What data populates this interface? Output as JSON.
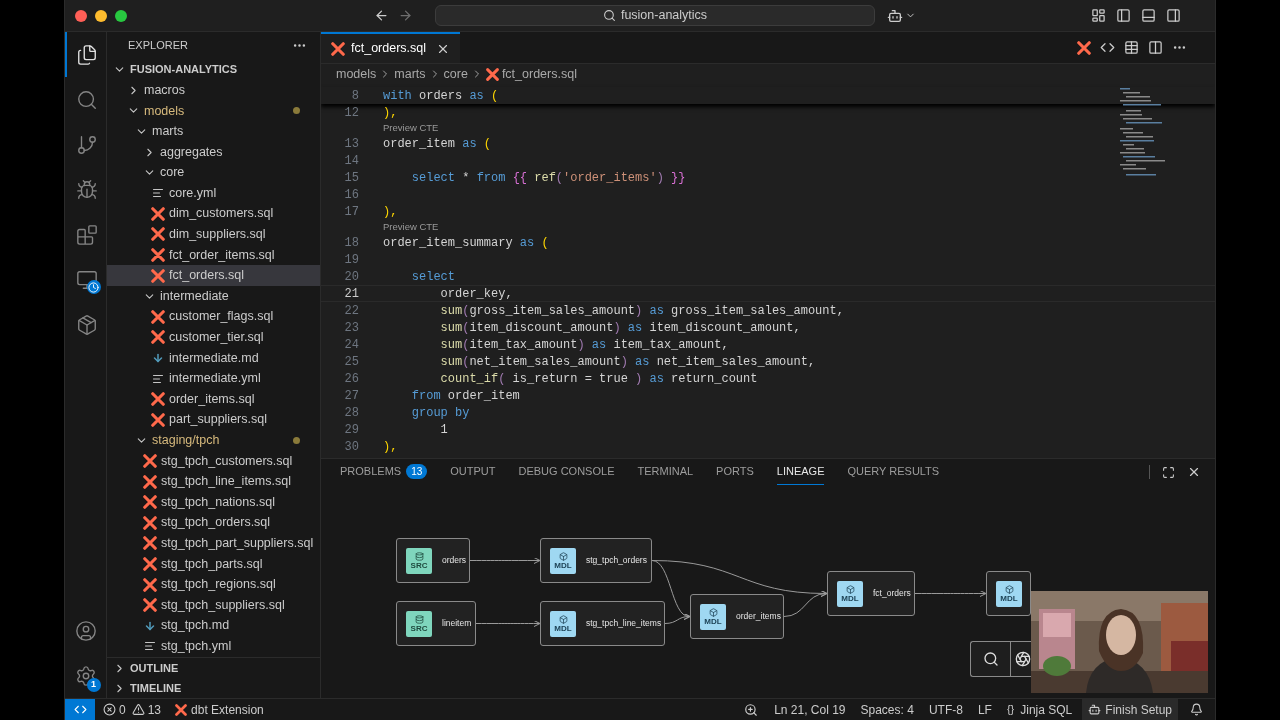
{
  "titlebar": {
    "search": "fusion-analytics"
  },
  "activity_bar": [
    {
      "kind": "files",
      "selected": true
    },
    {
      "kind": "search",
      "selected": false
    },
    {
      "kind": "git",
      "selected": false
    },
    {
      "kind": "debug",
      "selected": false
    },
    {
      "kind": "extensions",
      "selected": false
    },
    {
      "kind": "monitor",
      "selected": false
    },
    {
      "kind": "package",
      "selected": false
    }
  ],
  "activity_bottom": [
    {
      "kind": "account"
    },
    {
      "kind": "settings",
      "badge": "1"
    }
  ],
  "sidebar": {
    "title": "EXPLORER",
    "root": "FUSION-ANALYTICS",
    "items": [
      {
        "name": "macros",
        "kind": "folder",
        "expanded": false,
        "modified": false,
        "selected": false
      },
      {
        "name": "models",
        "kind": "folder",
        "expanded": true,
        "modified": true,
        "selected": false,
        "children": [
          {
            "name": "marts",
            "kind": "folder",
            "expanded": true,
            "modified": false,
            "selected": false,
            "children": [
              {
                "name": "aggregates",
                "kind": "folder",
                "expanded": false,
                "modified": false,
                "selected": false
              },
              {
                "name": "core",
                "kind": "folder",
                "expanded": true,
                "modified": false,
                "selected": false,
                "children": [
                  {
                    "name": "core.yml",
                    "kind": "yml",
                    "modified": false,
                    "selected": false
                  },
                  {
                    "name": "dim_customers.sql",
                    "kind": "dbt",
                    "modified": false,
                    "selected": false
                  },
                  {
                    "name": "dim_suppliers.sql",
                    "kind": "dbt",
                    "modified": false,
                    "selected": false
                  },
                  {
                    "name": "fct_order_items.sql",
                    "kind": "dbt",
                    "modified": false,
                    "selected": false
                  },
                  {
                    "name": "fct_orders.sql",
                    "kind": "dbt",
                    "modified": false,
                    "selected": true
                  }
                ]
              },
              {
                "name": "intermediate",
                "kind": "folder",
                "expanded": true,
                "modified": false,
                "selected": false,
                "children": [
                  {
                    "name": "customer_flags.sql",
                    "kind": "dbt",
                    "modified": false,
                    "selected": false
                  },
                  {
                    "name": "customer_tier.sql",
                    "kind": "dbt",
                    "modified": false,
                    "selected": false
                  },
                  {
                    "name": "intermediate.md",
                    "kind": "md",
                    "modified": false,
                    "selected": false
                  },
                  {
                    "name": "intermediate.yml",
                    "kind": "yml",
                    "modified": false,
                    "selected": false
                  },
                  {
                    "name": "order_items.sql",
                    "kind": "dbt",
                    "modified": false,
                    "selected": false
                  },
                  {
                    "name": "part_suppliers.sql",
                    "kind": "dbt",
                    "modified": false,
                    "selected": false
                  }
                ]
              }
            ]
          },
          {
            "name": "staging/tpch",
            "kind": "folder",
            "expanded": true,
            "modified": true,
            "selected": false,
            "children": [
              {
                "name": "stg_tpch_customers.sql",
                "kind": "dbt",
                "modified": false,
                "selected": false
              },
              {
                "name": "stg_tpch_line_items.sql",
                "kind": "dbt",
                "modified": false,
                "selected": false
              },
              {
                "name": "stg_tpch_nations.sql",
                "kind": "dbt",
                "modified": false,
                "selected": false
              },
              {
                "name": "stg_tpch_orders.sql",
                "kind": "dbt",
                "modified": false,
                "selected": false
              },
              {
                "name": "stg_tpch_part_suppliers.sql",
                "kind": "dbt",
                "modified": false,
                "selected": false
              },
              {
                "name": "stg_tpch_parts.sql",
                "kind": "dbt",
                "modified": false,
                "selected": false
              },
              {
                "name": "stg_tpch_regions.sql",
                "kind": "dbt",
                "modified": false,
                "selected": false
              },
              {
                "name": "stg_tpch_suppliers.sql",
                "kind": "dbt",
                "modified": false,
                "selected": false
              },
              {
                "name": "stg_tpch.md",
                "kind": "md",
                "modified": false,
                "selected": false
              },
              {
                "name": "stg_tpch.yml",
                "kind": "yml",
                "modified": false,
                "selected": false
              }
            ]
          }
        ]
      }
    ],
    "sections": [
      {
        "label": "OUTLINE",
        "expanded": false
      },
      {
        "label": "TIMELINE",
        "expanded": false
      }
    ]
  },
  "editor": {
    "tab": {
      "label": "fct_orders.sql"
    },
    "breadcrumb": [
      "models",
      "marts",
      "core",
      "fct_orders.sql"
    ],
    "lines": [
      {
        "kind": "code",
        "number": "8",
        "current": false,
        "tokens": [
          {
            "s": "with",
            "kind": "kw"
          },
          {
            "s": " orders ",
            "kind": "plain"
          },
          {
            "s": "as",
            "kind": "kw"
          },
          {
            "s": " (",
            "kind": "paren"
          }
        ]
      },
      {
        "kind": "code",
        "number": "12",
        "current": false,
        "tokens": [
          {
            "s": "),",
            "kind": "paren"
          }
        ]
      },
      {
        "kind": "codelens",
        "text": "Preview CTE"
      },
      {
        "kind": "code",
        "number": "13",
        "current": false,
        "tokens": [
          {
            "s": "order_item ",
            "kind": "plain"
          },
          {
            "s": "as",
            "kind": "kw"
          },
          {
            "s": " (",
            "kind": "paren"
          }
        ]
      },
      {
        "kind": "code",
        "number": "14",
        "current": false
      },
      {
        "kind": "code",
        "number": "15",
        "current": false,
        "tokens": [
          {
            "s": "    select",
            "kind": "kw"
          },
          {
            "s": " * ",
            "kind": "plain"
          },
          {
            "s": "from ",
            "kind": "kw"
          },
          {
            "s": "{{ ",
            "kind": "jinja"
          },
          {
            "s": "ref",
            "kind": "fn"
          },
          {
            "s": "(",
            "kind": "dim"
          },
          {
            "s": "'order_items'",
            "kind": "str"
          },
          {
            "s": ") ",
            "kind": "dim"
          },
          {
            "s": "}}",
            "kind": "jinja"
          }
        ]
      },
      {
        "kind": "code",
        "number": "16",
        "current": false
      },
      {
        "kind": "code",
        "number": "17",
        "current": false,
        "tokens": [
          {
            "s": "),",
            "kind": "paren"
          }
        ]
      },
      {
        "kind": "codelens",
        "text": "Preview CTE"
      },
      {
        "kind": "code",
        "number": "18",
        "current": false,
        "tokens": [
          {
            "s": "order_item_summary ",
            "kind": "plain"
          },
          {
            "s": "as",
            "kind": "kw"
          },
          {
            "s": " (",
            "kind": "paren"
          }
        ]
      },
      {
        "kind": "code",
        "number": "19",
        "current": false
      },
      {
        "kind": "code",
        "number": "20",
        "current": false,
        "tokens": [
          {
            "s": "    select",
            "kind": "kw"
          }
        ]
      },
      {
        "kind": "code",
        "number": "21",
        "current": true,
        "tokens": [
          {
            "s": "        order_key,",
            "kind": "plain"
          }
        ]
      },
      {
        "kind": "code",
        "number": "22",
        "current": false,
        "tokens": [
          {
            "s": "        sum",
            "kind": "fn"
          },
          {
            "s": "(",
            "kind": "dim"
          },
          {
            "s": "gross_item_sales_amount",
            "kind": "plain"
          },
          {
            "s": ") ",
            "kind": "dim"
          },
          {
            "s": "as",
            "kind": "kw"
          },
          {
            "s": " gross_item_sales_amount,",
            "kind": "plain"
          }
        ]
      },
      {
        "kind": "code",
        "number": "23",
        "current": false,
        "tokens": [
          {
            "s": "        sum",
            "kind": "fn"
          },
          {
            "s": "(",
            "kind": "dim"
          },
          {
            "s": "item_discount_amount",
            "kind": "plain"
          },
          {
            "s": ") ",
            "kind": "dim"
          },
          {
            "s": "as",
            "kind": "kw"
          },
          {
            "s": " item_discount_amount,",
            "kind": "plain"
          }
        ]
      },
      {
        "kind": "code",
        "number": "24",
        "current": false,
        "tokens": [
          {
            "s": "        sum",
            "kind": "fn"
          },
          {
            "s": "(",
            "kind": "dim"
          },
          {
            "s": "item_tax_amount",
            "kind": "plain"
          },
          {
            "s": ") ",
            "kind": "dim"
          },
          {
            "s": "as",
            "kind": "kw"
          },
          {
            "s": " item_tax_amount,",
            "kind": "plain"
          }
        ]
      },
      {
        "kind": "code",
        "number": "25",
        "current": false,
        "tokens": [
          {
            "s": "        sum",
            "kind": "fn"
          },
          {
            "s": "(",
            "kind": "dim"
          },
          {
            "s": "net_item_sales_amount",
            "kind": "plain"
          },
          {
            "s": ") ",
            "kind": "dim"
          },
          {
            "s": "as",
            "kind": "kw"
          },
          {
            "s": " net_item_sales_amount,",
            "kind": "plain"
          }
        ]
      },
      {
        "kind": "code",
        "number": "26",
        "current": false,
        "tokens": [
          {
            "s": "        count_if",
            "kind": "fn"
          },
          {
            "s": "(",
            "kind": "dim"
          },
          {
            "s": " is_return = true ",
            "kind": "plain"
          },
          {
            "s": ") ",
            "kind": "dim"
          },
          {
            "s": "as",
            "kind": "kw"
          },
          {
            "s": " return_count",
            "kind": "plain"
          }
        ]
      },
      {
        "kind": "code",
        "number": "27",
        "current": false,
        "tokens": [
          {
            "s": "    from",
            "kind": "kw"
          },
          {
            "s": " order_item",
            "kind": "plain"
          }
        ]
      },
      {
        "kind": "code",
        "number": "28",
        "current": false,
        "tokens": [
          {
            "s": "    group by",
            "kind": "kw"
          }
        ]
      },
      {
        "kind": "code",
        "number": "29",
        "current": false,
        "tokens": [
          {
            "s": "        1",
            "kind": "plain"
          }
        ]
      },
      {
        "kind": "code",
        "number": "30",
        "current": false,
        "tokens": [
          {
            "s": "),",
            "kind": "paren"
          }
        ]
      }
    ]
  },
  "panel": {
    "tabs": [
      {
        "label": "PROBLEMS",
        "badge": "13",
        "selected": false
      },
      {
        "label": "OUTPUT",
        "selected": false
      },
      {
        "label": "DEBUG CONSOLE",
        "selected": false
      },
      {
        "label": "TERMINAL",
        "selected": false
      },
      {
        "label": "PORTS",
        "selected": false
      },
      {
        "label": "LINEAGE",
        "selected": true
      },
      {
        "label": "QUERY RESULTS",
        "selected": false
      }
    ],
    "lineage": {
      "nodes": [
        {
          "kind": "source",
          "badge": "SRC",
          "label": "orders"
        },
        {
          "kind": "source",
          "badge": "SRC",
          "label": "lineitem"
        },
        {
          "kind": "model",
          "badge": "MDL",
          "label": "stg_tpch_orders"
        },
        {
          "kind": "model",
          "badge": "MDL",
          "label": "stg_tpch_line_items"
        },
        {
          "kind": "model",
          "badge": "MDL",
          "label": "order_items"
        },
        {
          "kind": "model",
          "badge": "MDL",
          "label": "fct_orders"
        },
        {
          "kind": "model",
          "badge": "MDL"
        }
      ]
    }
  },
  "status_bar": {
    "errors": "0",
    "warnings": "13",
    "extension": "dbt Extension",
    "position": "Ln 21, Col 19",
    "spaces": "Spaces: 4",
    "encoding": "UTF-8",
    "eol": "LF",
    "braces": "{}",
    "language": "Jinja SQL",
    "setup": "Finish Setup"
  }
}
